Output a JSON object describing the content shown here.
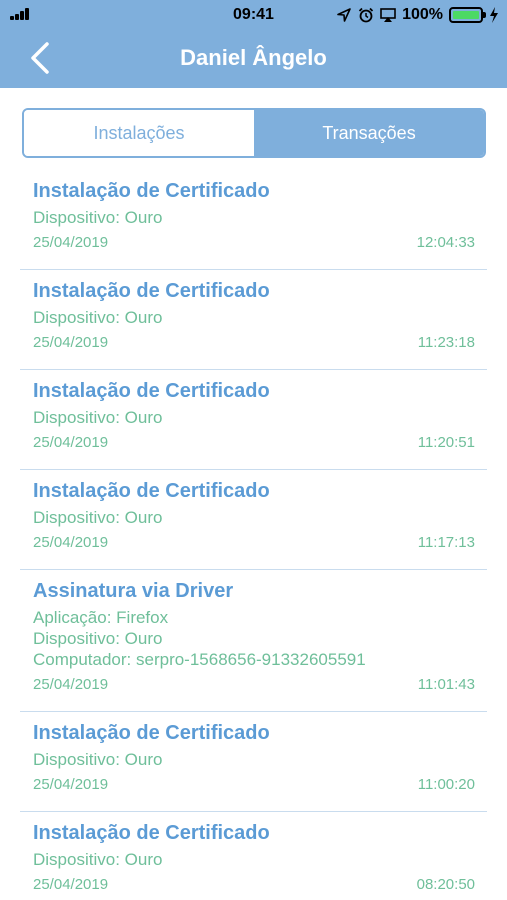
{
  "status_bar": {
    "time": "09:41",
    "battery": "100%",
    "icons": [
      "signal-icon",
      "location-icon",
      "alarm-icon",
      "airplay-icon",
      "battery-icon",
      "charging-icon"
    ]
  },
  "nav": {
    "title": "Daniel Ângelo",
    "back_icon": "chevron-left-icon"
  },
  "colors": {
    "header": "#7fafdc",
    "title_text": "#5b9bd5",
    "detail_text": "#6fbf9a"
  },
  "tabs": [
    {
      "label": "Instalações",
      "active": false
    },
    {
      "label": "Transações",
      "active": true
    }
  ],
  "transactions": [
    {
      "title": "Instalação de Certificado",
      "details": [
        "Dispositivo: Ouro"
      ],
      "date": "25/04/2019",
      "time": "12:04:33"
    },
    {
      "title": "Instalação de Certificado",
      "details": [
        "Dispositivo: Ouro"
      ],
      "date": "25/04/2019",
      "time": "11:23:18"
    },
    {
      "title": "Instalação de Certificado",
      "details": [
        "Dispositivo: Ouro"
      ],
      "date": "25/04/2019",
      "time": "11:20:51"
    },
    {
      "title": "Instalação de Certificado",
      "details": [
        "Dispositivo: Ouro"
      ],
      "date": "25/04/2019",
      "time": "11:17:13"
    },
    {
      "title": "Assinatura via Driver",
      "details": [
        "Aplicação: Firefox",
        "Dispositivo: Ouro",
        "Computador: serpro-1568656-91332605591"
      ],
      "date": "25/04/2019",
      "time": "11:01:43"
    },
    {
      "title": "Instalação de Certificado",
      "details": [
        "Dispositivo: Ouro"
      ],
      "date": "25/04/2019",
      "time": "11:00:20"
    },
    {
      "title": "Instalação de Certificado",
      "details": [
        "Dispositivo: Ouro"
      ],
      "date": "25/04/2019",
      "time": "08:20:50"
    }
  ]
}
